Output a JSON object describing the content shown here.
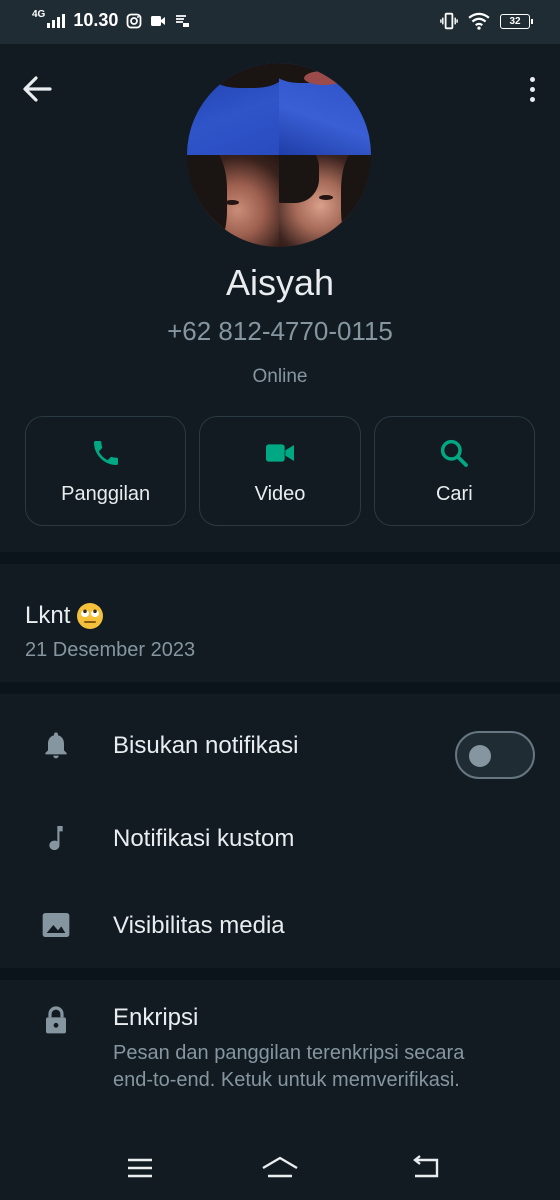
{
  "status_bar": {
    "network": "4G",
    "time": "10.30",
    "battery": "32"
  },
  "contact": {
    "name": "Aisyah",
    "phone": "+62 812-4770-0115",
    "status": "Online"
  },
  "actions": [
    {
      "label": "Panggilan",
      "icon": "phone-icon"
    },
    {
      "label": "Video",
      "icon": "video-icon"
    },
    {
      "label": "Cari",
      "icon": "search-icon"
    }
  ],
  "about": {
    "text": "Lknt",
    "emoji": "eye-roll-emoji",
    "date": "21 Desember 2023"
  },
  "settings": {
    "mute_label": "Bisukan notifikasi",
    "mute_enabled": false,
    "custom_notif_label": "Notifikasi kustom",
    "media_visibility_label": "Visibilitas media"
  },
  "encryption": {
    "title": "Enkripsi",
    "description": "Pesan dan panggilan terenkripsi secara end-to-end. Ketuk untuk memverifikasi."
  },
  "colors": {
    "accent": "#00a884",
    "background": "#111b21",
    "status_bar": "#1f2c34",
    "secondary_text": "#8696a0"
  }
}
